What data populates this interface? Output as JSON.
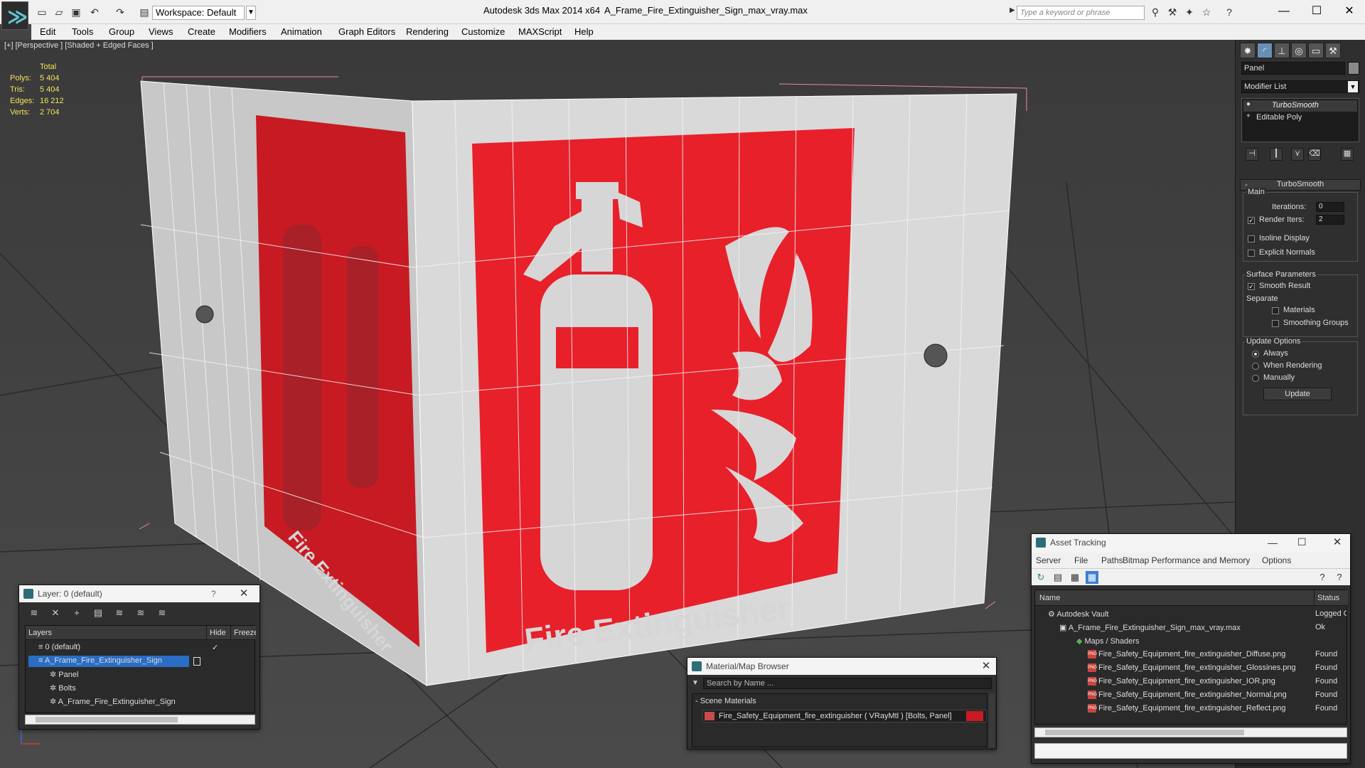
{
  "app": {
    "title": "Autodesk 3ds Max  2014 x64",
    "file": "A_Frame_Fire_Extinguisher_Sign_max_vray.max",
    "workspace": "Workspace: Default",
    "search_placeholder": "Type a keyword or phrase",
    "menu": [
      "Edit",
      "Tools",
      "Group",
      "Views",
      "Create",
      "Modifiers",
      "Animation",
      "Graph Editors",
      "Rendering",
      "Customize",
      "MAXScript",
      "Help"
    ]
  },
  "viewport": {
    "label": "[+] [Perspective ] [Shaded + Edged Faces ]",
    "stats_header": "Total",
    "stats": [
      {
        "label": "Polys:",
        "value": "5 404"
      },
      {
        "label": "Tris:",
        "value": "5 404"
      },
      {
        "label": "Edges:",
        "value": "16 212"
      },
      {
        "label": "Verts:",
        "value": "2 704"
      }
    ],
    "sign_text": "Fire Extinguisher",
    "sign_red": "#e8202a"
  },
  "command_panel": {
    "object_name": "Panel",
    "modifier_list": "Modifier List",
    "stack": [
      "TurboSmooth",
      "Editable Poly"
    ],
    "rollout_title": "TurboSmooth",
    "main_label": "Main",
    "iterations_label": "Iterations:",
    "iterations_value": "0",
    "render_iters_label": "Render Iters:",
    "render_iters_value": "2",
    "isoline_label": "Isoline Display",
    "explicit_normals_label": "Explicit Normals",
    "surface_params_label": "Surface Parameters",
    "smooth_result_label": "Smooth Result",
    "separate_label": "Separate",
    "materials_label": "Materials",
    "smoothing_groups_label": "Smoothing Groups",
    "update_options_label": "Update Options",
    "always_label": "Always",
    "when_rendering_label": "When Rendering",
    "manually_label": "Manually",
    "update_button": "Update"
  },
  "layer_window": {
    "title": "Layer: 0 (default)",
    "help": "?",
    "col_layers": "Layers",
    "col_hide": "Hide",
    "col_freeze": "Freeze",
    "rows": [
      {
        "name": "0 (default)"
      },
      {
        "name": "A_Frame_Fire_Extinguisher_Sign"
      },
      {
        "name": "Panel"
      },
      {
        "name": "Bolts"
      },
      {
        "name": "A_Frame_Fire_Extinguisher_Sign"
      }
    ]
  },
  "material_browser": {
    "title": "Material/Map Browser",
    "search_placeholder": "Search by Name ...",
    "group": "- Scene Materials",
    "item": "Fire_Safety_Equipment_fire_extinguisher  ( VRayMtl )  [Bolts, Panel]"
  },
  "asset_tracking": {
    "title": "Asset Tracking",
    "menu": [
      "Server",
      "File",
      "Paths",
      "Bitmap Performance and Memory",
      "Options"
    ],
    "col_name": "Name",
    "col_status": "Status",
    "rows": [
      {
        "name": "Autodesk Vault",
        "status": "Logged O"
      },
      {
        "name": "A_Frame_Fire_Extinguisher_Sign_max_vray.max",
        "status": "Ok"
      },
      {
        "name": "Maps / Shaders",
        "status": ""
      },
      {
        "name": "Fire_Safety_Equipment_fire_extinguisher_Diffuse.png",
        "status": "Found"
      },
      {
        "name": "Fire_Safety_Equipment_fire_extinguisher_Glossines.png",
        "status": "Found"
      },
      {
        "name": "Fire_Safety_Equipment_fire_extinguisher_IOR.png",
        "status": "Found"
      },
      {
        "name": "Fire_Safety_Equipment_fire_extinguisher_Normal.png",
        "status": "Found"
      },
      {
        "name": "Fire_Safety_Equipment_fire_extinguisher_Reflect.png",
        "status": "Found"
      }
    ]
  }
}
